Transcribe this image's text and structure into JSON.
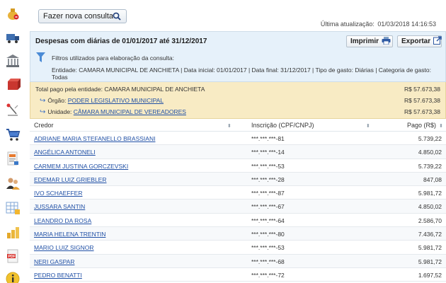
{
  "toolbar": {
    "search_button_label": "Fazer nova consulta",
    "last_update_label": "Última atualização:",
    "last_update_value": "01/03/2018 14:16:53"
  },
  "sidebar": {
    "items": [
      {
        "icon": "money-bag-icon"
      },
      {
        "icon": "truck-icon"
      },
      {
        "icon": "bank-building-icon"
      },
      {
        "icon": "brick-box-icon"
      },
      {
        "icon": "scales-icon"
      },
      {
        "icon": "shopping-cart-icon"
      },
      {
        "icon": "document-report-icon"
      },
      {
        "icon": "users-icon"
      },
      {
        "icon": "spreadsheet-icon"
      },
      {
        "icon": "coins-stack-icon"
      },
      {
        "icon": "pdf-document-icon"
      },
      {
        "icon": "info-icon"
      }
    ]
  },
  "report": {
    "title": "Despesas com diárias de 01/01/2017 até 31/12/2017",
    "print_label": "Imprimir",
    "export_label": "Exportar",
    "filters_label": "Filtros utilizados para elaboração da consulta:",
    "filters_text": "Entidade: CAMARA MUNICIPAL DE ANCHIETA | Data inicial: 01/01/2017 | Data final: 31/12/2017 | Tipo de gasto: Diárias | Categoria de gasto: Todas"
  },
  "totals": {
    "entity_label": "Total pago pela entidade: CAMARA MUNICIPAL DE ANCHIETA",
    "entity_value": "R$ 57.673,38",
    "orgao_prefix": "Órgão:",
    "orgao_name": "PODER LEGISLATIVO MUNICIPAL",
    "orgao_value": "R$ 57.673,38",
    "unidade_prefix": "Unidade:",
    "unidade_name": "CÂMARA MUNICIPAL DE VEREADORES",
    "unidade_value": "R$ 57.673,38"
  },
  "table": {
    "columns": [
      "Credor",
      "Inscrição (CPF/CNPJ)",
      "Pago (R$)"
    ],
    "rows": [
      {
        "credor": "ADRIANE MARIA STEFANELLO BRASSIANI",
        "inscricao": "***.***.***-81",
        "pago": "5.739,22"
      },
      {
        "credor": "ANGÉLICA ANTONELI",
        "inscricao": "***.***.***-14",
        "pago": "4.850,02"
      },
      {
        "credor": "CARMEM JUSTINA GORCZEVSKI",
        "inscricao": "***.***.***-53",
        "pago": "5.739,22"
      },
      {
        "credor": "EDEMAR LUIZ GRIEBLER",
        "inscricao": "***.***.***-28",
        "pago": "847,08"
      },
      {
        "credor": "IVO SCHAEFFER",
        "inscricao": "***.***.***-87",
        "pago": "5.981,72"
      },
      {
        "credor": "JUSSARA SANTIN",
        "inscricao": "***.***.***-67",
        "pago": "4.850,02"
      },
      {
        "credor": "LEANDRO DA ROSA",
        "inscricao": "***.***.***-64",
        "pago": "2.586,70"
      },
      {
        "credor": "MARIA HELENA TRENTIN",
        "inscricao": "***.***.***-80",
        "pago": "7.436,72"
      },
      {
        "credor": "MARIO LUIZ SIGNOR",
        "inscricao": "***.***.***-53",
        "pago": "5.981,72"
      },
      {
        "credor": "NERI GASPAR",
        "inscricao": "***.***.***-68",
        "pago": "5.981,72"
      },
      {
        "credor": "PEDRO BENATTI",
        "inscricao": "***.***.***-72",
        "pago": "1.697,52"
      }
    ]
  }
}
